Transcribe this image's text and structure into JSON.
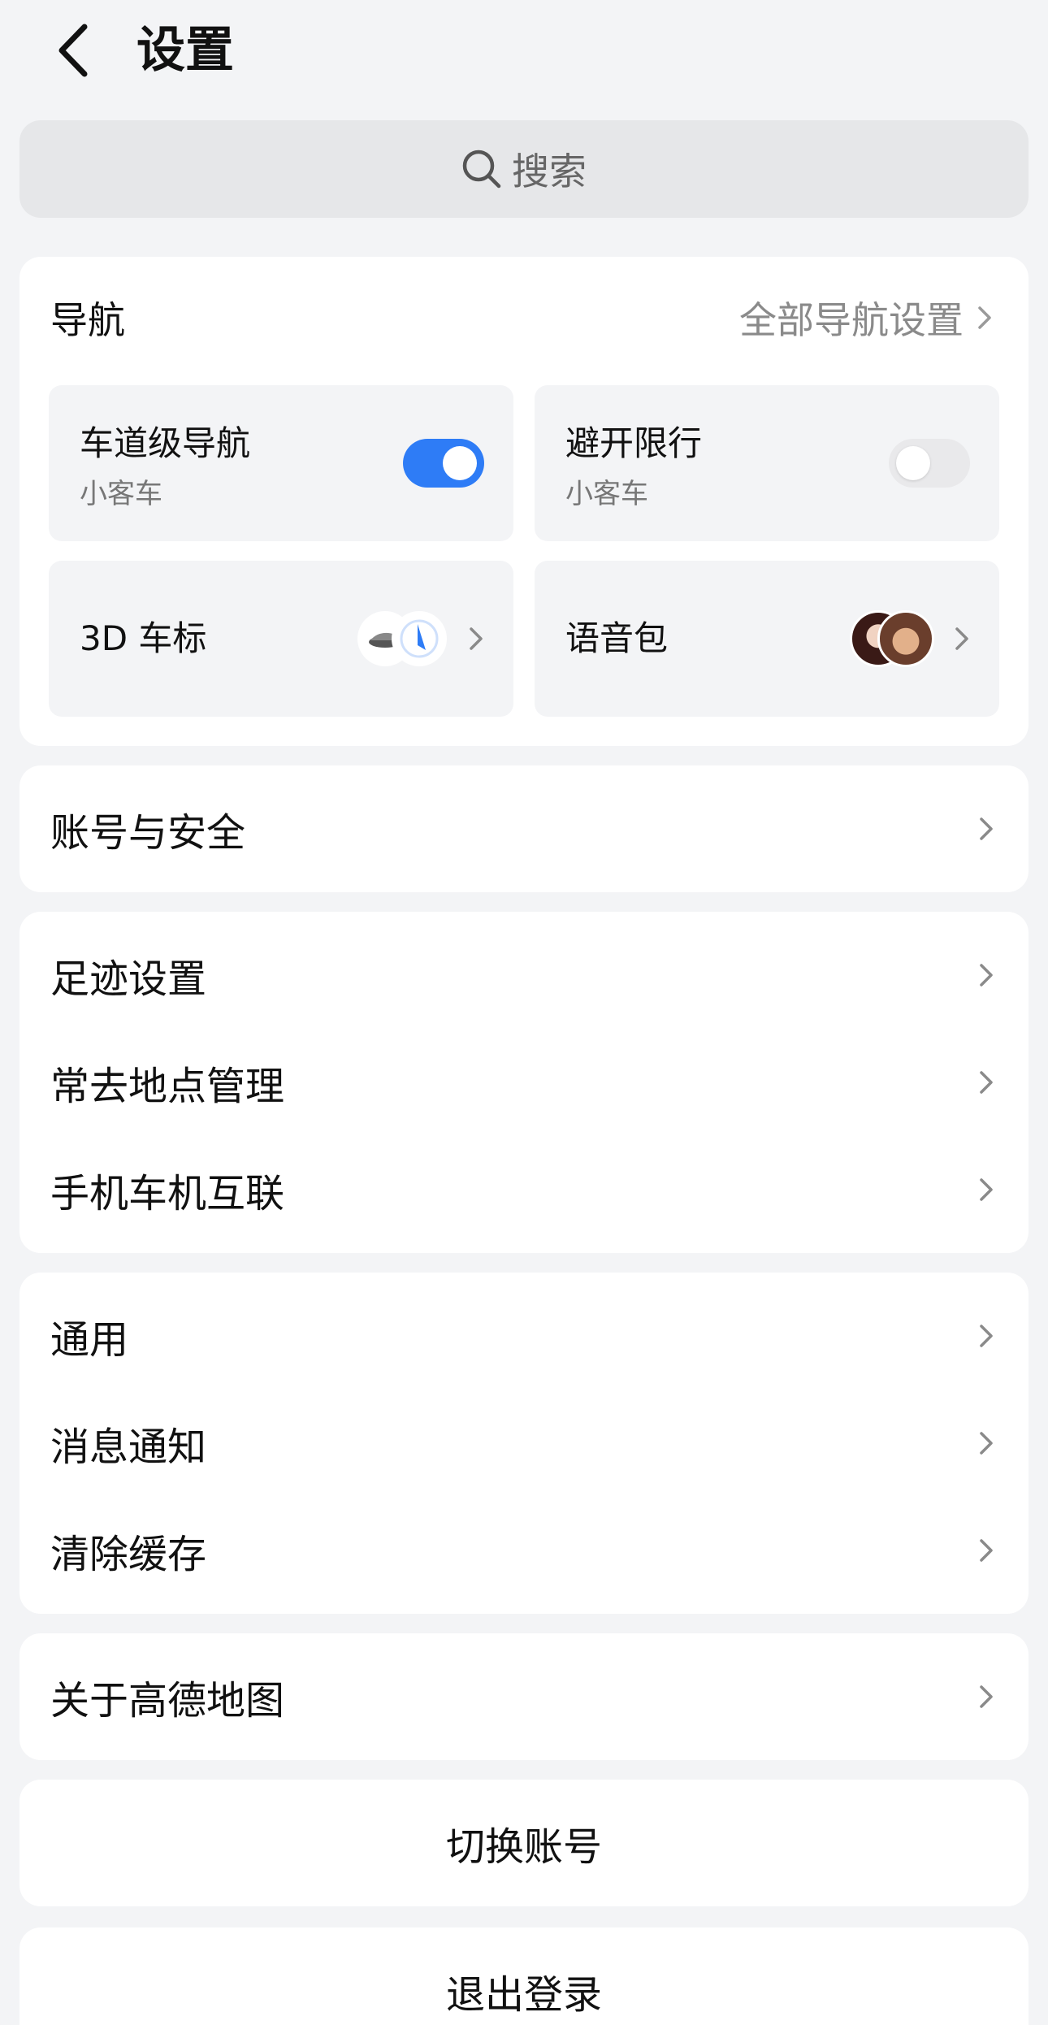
{
  "header": {
    "title": "设置"
  },
  "search": {
    "placeholder": "搜索"
  },
  "navigation": {
    "title": "导航",
    "all_settings": "全部导航设置",
    "tiles": [
      {
        "title": "车道级导航",
        "subtitle": "小客车",
        "toggle": "on"
      },
      {
        "title": "避开限行",
        "subtitle": "小客车",
        "toggle": "off"
      },
      {
        "title": "3D 车标"
      },
      {
        "title": "语音包"
      }
    ]
  },
  "account_security": {
    "label": "账号与安全"
  },
  "group2": [
    {
      "label": "足迹设置"
    },
    {
      "label": "常去地点管理"
    },
    {
      "label": "手机车机互联"
    }
  ],
  "group3": [
    {
      "label": "通用"
    },
    {
      "label": "消息通知"
    },
    {
      "label": "清除缓存"
    }
  ],
  "about": {
    "label": "关于高德地图"
  },
  "switch_account": {
    "label": "切换账号"
  },
  "logout": {
    "label": "退出登录"
  },
  "colors": {
    "accent": "#2e7cf6",
    "background": "#f3f4f6",
    "card": "#ffffff"
  }
}
